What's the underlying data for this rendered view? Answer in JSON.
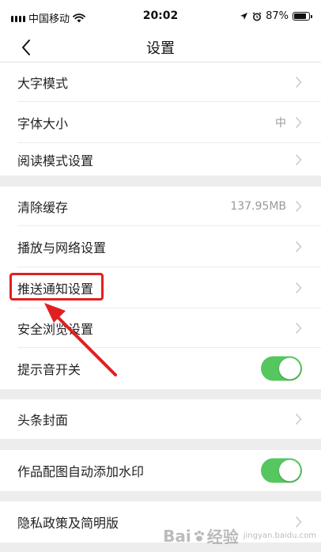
{
  "status_bar": {
    "carrier": "中国移动",
    "time": "20:02",
    "battery_percent": "87%"
  },
  "nav": {
    "title": "设置"
  },
  "groups": [
    {
      "items": [
        {
          "label": "大字模式",
          "value": "",
          "control": "chevron"
        },
        {
          "label": "字体大小",
          "value": "中",
          "control": "chevron"
        },
        {
          "label": "阅读模式设置",
          "value": "",
          "control": "chevron"
        }
      ]
    },
    {
      "items": [
        {
          "label": "清除缓存",
          "value": "137.95MB",
          "control": "chevron"
        },
        {
          "label": "播放与网络设置",
          "value": "",
          "control": "chevron"
        },
        {
          "label": "推送通知设置",
          "value": "",
          "control": "chevron",
          "highlighted": true
        },
        {
          "label": "安全浏览设置",
          "value": "",
          "control": "chevron"
        },
        {
          "label": "提示音开关",
          "value": "",
          "control": "toggle",
          "toggle_on": true
        }
      ]
    },
    {
      "items": [
        {
          "label": "头条封面",
          "value": "",
          "control": "chevron"
        }
      ]
    },
    {
      "items": [
        {
          "label": "作品配图自动添加水印",
          "value": "",
          "control": "toggle",
          "toggle_on": true
        }
      ]
    },
    {
      "items": [
        {
          "label": "隐私政策及简明版",
          "value": "",
          "control": "chevron"
        }
      ]
    }
  ],
  "colors": {
    "toggle_on": "#56c65f",
    "annotation_red": "#e02020",
    "background": "#ededed"
  },
  "watermark": {
    "brand": "Bai",
    "brand_tail": "经验",
    "sub": "jingyan.baidu.com"
  }
}
